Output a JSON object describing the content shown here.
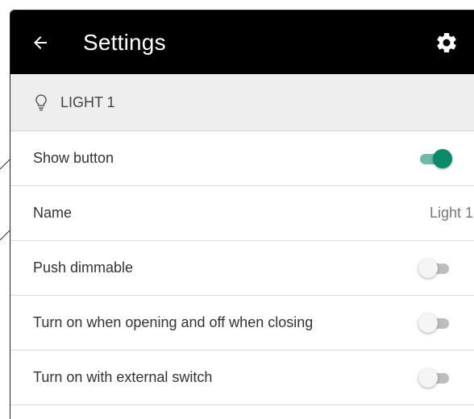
{
  "appbar": {
    "back_icon": "arrow-left-icon",
    "title": "Settings",
    "settings_icon": "gear-icon"
  },
  "section": {
    "icon": "lightbulb-icon",
    "label": "LIGHT 1"
  },
  "rows": [
    {
      "label": "Show button",
      "control": "toggle",
      "on": true
    },
    {
      "label": "Name",
      "control": "value",
      "value": "Light 1"
    },
    {
      "label": "Push dimmable",
      "control": "toggle",
      "on": false
    },
    {
      "label": "Turn on when opening and off when closing",
      "control": "toggle",
      "on": false
    },
    {
      "label": "Turn on with external switch",
      "control": "toggle",
      "on": false
    }
  ],
  "colors": {
    "appbar": "#000000",
    "accent": "#0a8a6b",
    "section_bg": "#eeeeee"
  }
}
